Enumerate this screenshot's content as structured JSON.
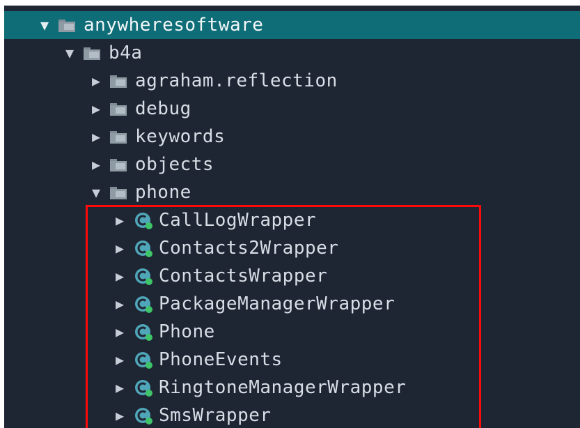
{
  "tree": {
    "root": {
      "label": "anywheresoftware",
      "icon": "folder-icon",
      "expanded": true,
      "selected": true
    },
    "b4a": {
      "label": "b4a",
      "icon": "folder-icon",
      "expanded": true
    },
    "packages": [
      {
        "label": "agraham.reflection",
        "icon": "folder-icon",
        "expanded": false
      },
      {
        "label": "debug",
        "icon": "folder-icon",
        "expanded": false
      },
      {
        "label": "keywords",
        "icon": "folder-icon",
        "expanded": false
      },
      {
        "label": "objects",
        "icon": "folder-icon",
        "expanded": false
      },
      {
        "label": "phone",
        "icon": "folder-icon",
        "expanded": true
      }
    ],
    "classes": [
      {
        "label": "CallLogWrapper",
        "icon": "class-icon"
      },
      {
        "label": "Contacts2Wrapper",
        "icon": "class-icon"
      },
      {
        "label": "ContactsWrapper",
        "icon": "class-icon"
      },
      {
        "label": "PackageManagerWrapper",
        "icon": "class-icon"
      },
      {
        "label": "Phone",
        "icon": "class-icon"
      },
      {
        "label": "PhoneEvents",
        "icon": "class-icon"
      },
      {
        "label": "RingtoneManagerWrapper",
        "icon": "class-icon"
      },
      {
        "label": "SmsWrapper",
        "icon": "class-icon"
      }
    ]
  },
  "colors": {
    "background": "#1f2633",
    "selected_row": "#0f6d78",
    "highlight_border": "#ff0a0a",
    "class_icon": "#4fa6b8",
    "class_badge": "#3fc46a"
  }
}
